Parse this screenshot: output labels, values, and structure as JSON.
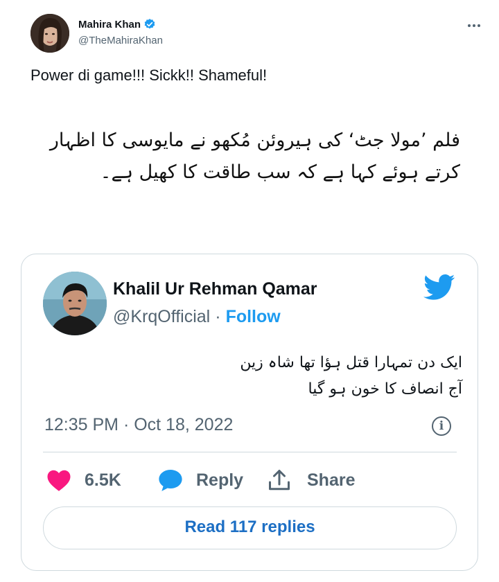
{
  "tweet": {
    "author_name": "Mahira Khan",
    "author_handle": "@TheMahiraKhan",
    "text": "Power di game!!! Sickk!! Shameful!"
  },
  "caption": {
    "urdu_line1": "فلم ’مولا جٹ‘ کی ہیروئن مُکھو نے مایوسی کا اظہار",
    "urdu_line2": "کرتے ہوئے کہا ہے کہ سب طاقت کا کھیل ہے۔"
  },
  "embedded_tweet": {
    "author_name": "Khalil Ur Rehman Qamar",
    "author_handle": "@KrqOfficial",
    "separator": "·",
    "follow_label": "Follow",
    "text_line1": "ایک دن تمہارا قتل ہؤا تھا شاہ زین",
    "text_line2": "آج انصاف کا خون ہو گیا",
    "timestamp": "12:35 PM · Oct 18, 2022",
    "info_symbol": "i",
    "like_count": "6.5K",
    "reply_label": "Reply",
    "share_label": "Share",
    "read_replies_label": "Read 117 replies"
  },
  "icons": {
    "verified": "verified-badge-icon",
    "more": "more-options-icon",
    "bird": "twitter-bird-icon",
    "heart": "heart-icon",
    "reply": "reply-bubble-icon",
    "share": "share-icon",
    "info": "info-icon"
  },
  "colors": {
    "twitter_blue": "#1d9bf0",
    "heart_red": "#f91880",
    "secondary_text": "#536471",
    "border": "#cfd9de"
  }
}
